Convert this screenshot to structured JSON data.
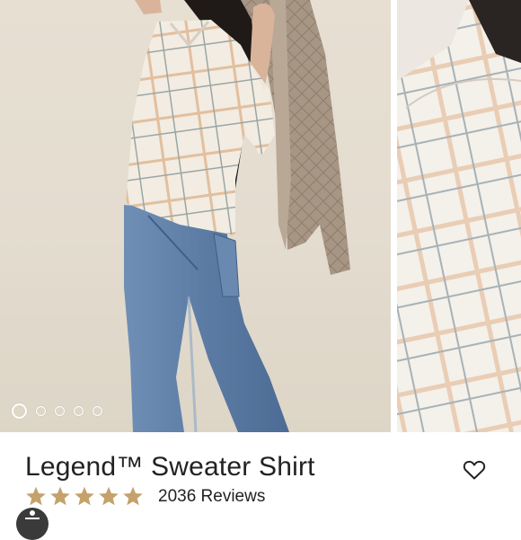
{
  "product": {
    "title": "Legend™ Sweater Shirt",
    "rating": 5,
    "rating_max": 5,
    "reviews_label": "2036 Reviews"
  },
  "gallery": {
    "image_count": 5,
    "active_index": 0,
    "images": [
      {
        "icon": "model-photo"
      },
      {
        "icon": "fabric-closeup-photo"
      }
    ]
  },
  "icons": {
    "favorite": "heart-outline-icon",
    "star": "star-icon",
    "assistant": "accessibility-icon"
  },
  "colors": {
    "star": "#c5a26c",
    "text": "#222222",
    "dot": "#ffffff"
  }
}
